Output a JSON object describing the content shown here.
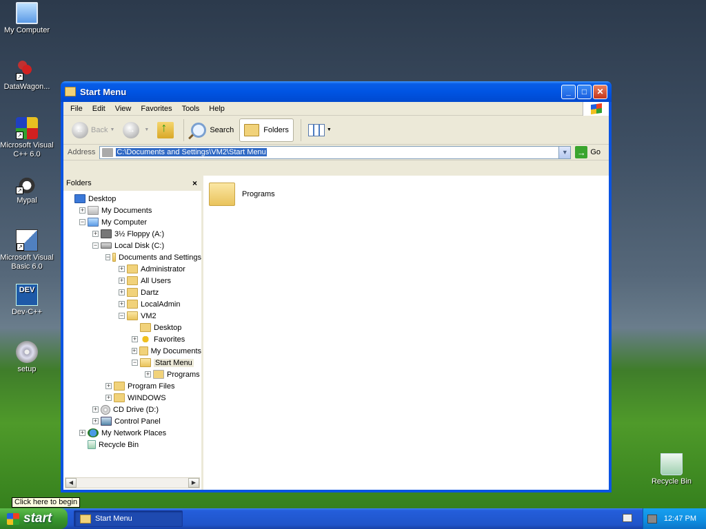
{
  "desktop": {
    "icons": [
      {
        "label": "My Computer",
        "icon": "my-computer-icon"
      },
      {
        "label": "DataWagon...",
        "icon": "datawagon-icon"
      },
      {
        "label": "Microsoft Visual C++ 6.0",
        "icon": "visual-cpp-icon"
      },
      {
        "label": "Mypal",
        "icon": "mypal-icon"
      },
      {
        "label": "Microsoft Visual Basic 6.0",
        "icon": "visual-basic-icon"
      },
      {
        "label": "Dev-C++",
        "icon": "dev-cpp-icon",
        "glyph": "DEV"
      },
      {
        "label": "setup",
        "icon": "setup-disc-icon"
      },
      {
        "label": "Recycle Bin",
        "icon": "recycle-bin-icon"
      }
    ]
  },
  "window": {
    "title": "Start Menu",
    "menu": [
      "File",
      "Edit",
      "View",
      "Favorites",
      "Tools",
      "Help"
    ],
    "toolbar": {
      "back": "Back",
      "search": "Search",
      "folders": "Folders"
    },
    "address": {
      "label": "Address",
      "value": "C:\\Documents and Settings\\VM2\\Start Menu",
      "go": "Go"
    },
    "folders_pane": {
      "title": "Folders",
      "close": "×",
      "tree": [
        {
          "label": "Desktop",
          "level": 0,
          "expander": "none",
          "icon": "desk"
        },
        {
          "label": "My Documents",
          "level": 1,
          "expander": "+",
          "icon": "docs"
        },
        {
          "label": "My Computer",
          "level": 1,
          "expander": "-",
          "icon": "comp"
        },
        {
          "label": "3½ Floppy (A:)",
          "level": 2,
          "expander": "+",
          "icon": "floppy"
        },
        {
          "label": "Local Disk (C:)",
          "level": 2,
          "expander": "-",
          "icon": "disk"
        },
        {
          "label": "Documents and Settings",
          "level": 3,
          "expander": "-",
          "icon": "open"
        },
        {
          "label": "Administrator",
          "level": 4,
          "expander": "+",
          "icon": ""
        },
        {
          "label": "All Users",
          "level": 4,
          "expander": "+",
          "icon": ""
        },
        {
          "label": "Dartz",
          "level": 4,
          "expander": "+",
          "icon": ""
        },
        {
          "label": "LocalAdmin",
          "level": 4,
          "expander": "+",
          "icon": ""
        },
        {
          "label": "VM2",
          "level": 4,
          "expander": "-",
          "icon": "open"
        },
        {
          "label": "Desktop",
          "level": 5,
          "expander": "none",
          "icon": ""
        },
        {
          "label": "Favorites",
          "level": 5,
          "expander": "+",
          "icon": "fav"
        },
        {
          "label": "My Documents",
          "level": 5,
          "expander": "+",
          "icon": ""
        },
        {
          "label": "Start Menu",
          "level": 5,
          "expander": "-",
          "icon": "open",
          "selected": true
        },
        {
          "label": "Programs",
          "level": 6,
          "expander": "+",
          "icon": "progs"
        },
        {
          "label": "Program Files",
          "level": 3,
          "expander": "+",
          "icon": ""
        },
        {
          "label": "WINDOWS",
          "level": 3,
          "expander": "+",
          "icon": ""
        },
        {
          "label": "CD Drive (D:)",
          "level": 2,
          "expander": "+",
          "icon": "cd"
        },
        {
          "label": "Control Panel",
          "level": 2,
          "expander": "+",
          "icon": "cpanel"
        },
        {
          "label": "My Network Places",
          "level": 1,
          "expander": "+",
          "icon": "net"
        },
        {
          "label": "Recycle Bin",
          "level": 1,
          "expander": "none",
          "icon": "recycle"
        }
      ]
    },
    "content": {
      "items": [
        {
          "label": "Programs"
        }
      ]
    }
  },
  "taskbar": {
    "start": "start",
    "task": "Start Menu",
    "clock": "12:47 PM",
    "tooltip": "Click here to begin"
  }
}
